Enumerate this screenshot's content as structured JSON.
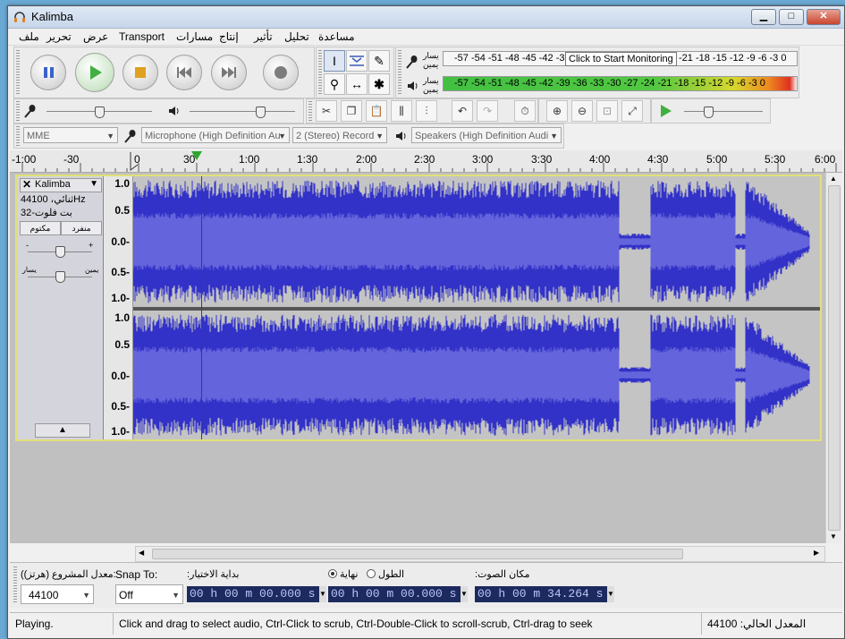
{
  "window": {
    "title": "Kalimba",
    "min": "▁",
    "max": "□",
    "close": "✕"
  },
  "menu": {
    "items": [
      "ملف",
      "تحرير",
      "عرض",
      "Transport",
      "مسارات",
      "إنتاج",
      "تأثير",
      "تحليل",
      "مساعدة"
    ]
  },
  "meters": {
    "record_labels": [
      "يسار",
      "يمين"
    ],
    "record_scale": "-57 -54 -51 -48 -45 -42 -3",
    "record_scale_right": "-21 -18 -15 -12 -9 -6 -3 0",
    "monitor_tooltip": "Click to Start Monitoring",
    "play_labels": [
      "يسار",
      "يمين"
    ],
    "play_scale": "-57 -54 -51 -48 -45 -42 -39 -36 -33 -30 -27 -24 -21 -18 -15 -12 -9 -6 -3 0"
  },
  "devices": {
    "host": "MME",
    "mic": "Microphone (High Definition Au",
    "channels": "2 (Stereo) Record",
    "speakers": "Speakers (High Definition Audi"
  },
  "ruler": {
    "ticks": [
      "-1:00",
      "-30",
      "0",
      "30",
      "1:00",
      "1:30",
      "2:00",
      "2:30",
      "3:00",
      "3:30",
      "4:00",
      "4:30",
      "5:00",
      "5:30",
      "6:00"
    ]
  },
  "track": {
    "name": "Kalimba",
    "info1": "44100 ،ثنائيHz",
    "info2": "بت فلوت-32",
    "mute": "مكتوم",
    "solo": "منفرد",
    "pan_left": "يسار",
    "pan_right": "يمين",
    "gain_minus": "-",
    "gain_plus": "+",
    "scale": [
      "1.0",
      "0.5",
      "0.0-",
      "0.5-",
      "1.0-"
    ]
  },
  "selection": {
    "rate_label": "(معدل المشروع (هرتز):",
    "rate_value": "44100",
    "snap_label": "Snap To:",
    "snap_value": "Off",
    "start_label": ":بداية الاختيار",
    "end_label": "نهاية",
    "length_label": "الطول",
    "audio_pos_label": ":مكان الصوت",
    "start_value": "00 h 00 m 00.000 s",
    "end_value": "00 h 00 m 00.000 s",
    "audio_pos_value": "00 h 00 m 34.264 s"
  },
  "status": {
    "state": "Playing.",
    "hint": "Click and drag to select audio, Ctrl-Click to scrub, Ctrl-Double-Click to scroll-scrub, Ctrl-drag to seek",
    "rate": "44100 :المعدل الحالي"
  },
  "colors": {
    "wave": "#3232c8",
    "wave_rms": "#6464dc",
    "wave_bg": "#c4c4c4",
    "track_border": "#e1df7a",
    "time_field": "#1d2a5f"
  }
}
